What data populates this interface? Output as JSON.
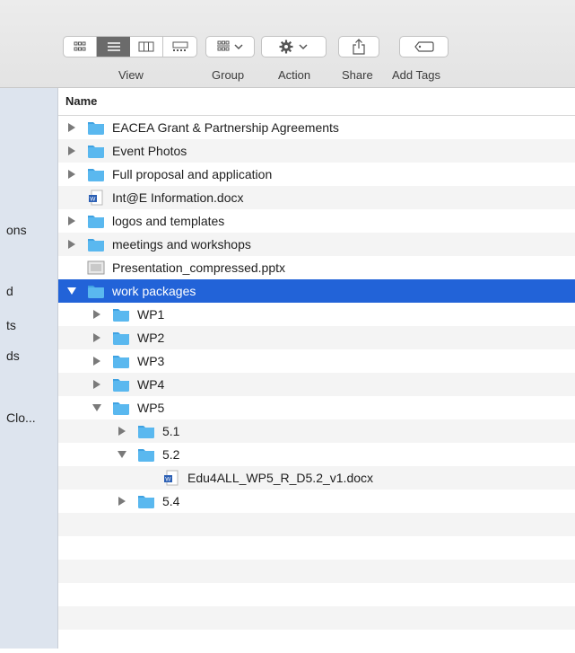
{
  "toolbar": {
    "view_label": "View",
    "group_label": "Group",
    "action_label": "Action",
    "share_label": "Share",
    "tags_label": "Add Tags"
  },
  "sidebar": {
    "fragments": [
      "ons",
      "d",
      "ts",
      "ds",
      "Clo..."
    ]
  },
  "list": {
    "header": "Name",
    "rows": [
      {
        "label": "EACEA Grant & Partnership Agreements",
        "kind": "folder",
        "depth": 0,
        "expanded": false
      },
      {
        "label": "Event Photos",
        "kind": "folder",
        "depth": 0,
        "expanded": false
      },
      {
        "label": "Full proposal and application",
        "kind": "folder",
        "depth": 0,
        "expanded": false
      },
      {
        "label": "Int@E Information.docx",
        "kind": "docx",
        "depth": 0
      },
      {
        "label": "logos and templates",
        "kind": "folder",
        "depth": 0,
        "expanded": false
      },
      {
        "label": "meetings and workshops",
        "kind": "folder",
        "depth": 0,
        "expanded": false
      },
      {
        "label": "Presentation_compressed.pptx",
        "kind": "pptx",
        "depth": 0
      },
      {
        "label": "work packages",
        "kind": "folder",
        "depth": 0,
        "expanded": true,
        "selected": true
      },
      {
        "label": "WP1",
        "kind": "folder",
        "depth": 1,
        "expanded": false
      },
      {
        "label": "WP2",
        "kind": "folder",
        "depth": 1,
        "expanded": false
      },
      {
        "label": "WP3",
        "kind": "folder",
        "depth": 1,
        "expanded": false
      },
      {
        "label": "WP4",
        "kind": "folder",
        "depth": 1,
        "expanded": false
      },
      {
        "label": "WP5",
        "kind": "folder",
        "depth": 1,
        "expanded": true
      },
      {
        "label": "5.1",
        "kind": "folder",
        "depth": 2,
        "expanded": false
      },
      {
        "label": "5.2",
        "kind": "folder",
        "depth": 2,
        "expanded": true
      },
      {
        "label": "Edu4ALL_WP5_R_D5.2_v1.docx",
        "kind": "docx",
        "depth": 3
      },
      {
        "label": "5.4",
        "kind": "folder",
        "depth": 2,
        "expanded": false
      }
    ]
  },
  "colors": {
    "folder": "#5ab8ef",
    "selection": "#2263d8",
    "sidebar": "#dde4ee"
  }
}
